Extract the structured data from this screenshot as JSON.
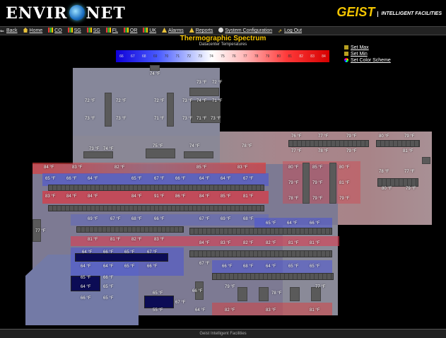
{
  "app": {
    "brand_left": "ENVIR",
    "brand_right": "NET",
    "vendor": "GEIST",
    "vendor_tag": "INTELLIGENT FACILITIES"
  },
  "nav": [
    {
      "label": "Back",
      "icon": "back-arrow-icon"
    },
    {
      "label": "Home",
      "icon": "home-icon"
    },
    {
      "label": "CO",
      "icon": "bar-chart-icon"
    },
    {
      "label": "SG",
      "icon": "bar-chart-icon"
    },
    {
      "label": "SG",
      "icon": "bar-chart-icon"
    },
    {
      "label": "FL",
      "icon": "bar-chart-icon"
    },
    {
      "label": "OR",
      "icon": "bar-chart-icon"
    },
    {
      "label": "UK",
      "icon": "bar-chart-icon"
    },
    {
      "label": "Alarms",
      "icon": "alarm-icon"
    },
    {
      "label": "Reports",
      "icon": "reports-icon"
    },
    {
      "label": "System Configuration",
      "icon": "gear-icon"
    },
    {
      "label": "Log Out",
      "icon": "logout-icon"
    }
  ],
  "title": "Thermographic Spectrum",
  "subtitle": "Datacenter Temperatures",
  "scale_values": [
    "66",
    "67",
    "68",
    "69",
    "70",
    "71",
    "72",
    "73",
    "74",
    "75",
    "76",
    "77",
    "78",
    "79",
    "80",
    "81",
    "82",
    "83",
    "84"
  ],
  "side_links": {
    "set_max": "Set Max",
    "set_min": "Set Min",
    "set_color_scheme": "Set Color Scheme"
  },
  "colors": {
    "accent": "#f5c400",
    "cold": "#0f00d8",
    "hot": "#d60000"
  },
  "temps": [
    {
      "t": "74 °F"
    },
    {
      "t": "73 °F"
    },
    {
      "t": "72 °F"
    },
    {
      "t": "72 °F"
    },
    {
      "t": "72 °F"
    },
    {
      "t": "72 °F"
    },
    {
      "t": "73 °F"
    },
    {
      "t": "74 °F"
    },
    {
      "t": "71 °F"
    },
    {
      "t": "73 °F"
    },
    {
      "t": "73 °F"
    },
    {
      "t": "71 °F"
    },
    {
      "t": "73 °F"
    },
    {
      "t": "71 °F"
    },
    {
      "t": "73 °F"
    },
    {
      "t": "76 °F"
    },
    {
      "t": "77 °F"
    },
    {
      "t": "79 °F"
    },
    {
      "t": "80 °F"
    },
    {
      "t": "79 °F"
    },
    {
      "t": "77 °F"
    },
    {
      "t": "78 °F"
    },
    {
      "t": "79 °F"
    },
    {
      "t": "81 °F"
    },
    {
      "t": "73 °F"
    },
    {
      "t": "74 °F"
    },
    {
      "t": "75 °F"
    },
    {
      "t": "74 °F"
    },
    {
      "t": "78 °F"
    },
    {
      "t": "84 °F"
    },
    {
      "t": "83 °F"
    },
    {
      "t": "82 °F"
    },
    {
      "t": "85 °F"
    },
    {
      "t": "83 °F"
    },
    {
      "t": "80 °F"
    },
    {
      "t": "85 °F"
    },
    {
      "t": "80 °F"
    },
    {
      "t": "78 °F"
    },
    {
      "t": "77 °F"
    },
    {
      "t": "65 °F"
    },
    {
      "t": "66 °F"
    },
    {
      "t": "64 °F"
    },
    {
      "t": "65 °F"
    },
    {
      "t": "67 °F"
    },
    {
      "t": "66 °F"
    },
    {
      "t": "64 °F"
    },
    {
      "t": "64 °F"
    },
    {
      "t": "67 °F"
    },
    {
      "t": "79 °F"
    },
    {
      "t": "79 °F"
    },
    {
      "t": "81 °F"
    },
    {
      "t": "80 °F"
    },
    {
      "t": "79 °F"
    },
    {
      "t": "83 °F"
    },
    {
      "t": "84 °F"
    },
    {
      "t": "84 °F"
    },
    {
      "t": "84 °F"
    },
    {
      "t": "91 °F"
    },
    {
      "t": "86 °F"
    },
    {
      "t": "84 °F"
    },
    {
      "t": "85 °F"
    },
    {
      "t": "81 °F"
    },
    {
      "t": "78 °F"
    },
    {
      "t": "79 °F"
    },
    {
      "t": "79 °F"
    },
    {
      "t": "69 °F"
    },
    {
      "t": "67 °F"
    },
    {
      "t": "68 °F"
    },
    {
      "t": "66 °F"
    },
    {
      "t": "67 °F"
    },
    {
      "t": "69 °F"
    },
    {
      "t": "68 °F"
    },
    {
      "t": "65 °F"
    },
    {
      "t": "64 °F"
    },
    {
      "t": "66 °F"
    },
    {
      "t": "77 °F"
    },
    {
      "t": "81 °F"
    },
    {
      "t": "81 °F"
    },
    {
      "t": "82 °F"
    },
    {
      "t": "83 °F"
    },
    {
      "t": "84 °F"
    },
    {
      "t": "83 °F"
    },
    {
      "t": "82 °F"
    },
    {
      "t": "82 °F"
    },
    {
      "t": "81 °F"
    },
    {
      "t": "81 °F"
    },
    {
      "t": "64 °F"
    },
    {
      "t": "66 °F"
    },
    {
      "t": "65 °F"
    },
    {
      "t": "67 °F"
    },
    {
      "t": "64 °F"
    },
    {
      "t": "64 °F"
    },
    {
      "t": "65 °F"
    },
    {
      "t": "66 °F"
    },
    {
      "t": "67 °F"
    },
    {
      "t": "66 °F"
    },
    {
      "t": "68 °F"
    },
    {
      "t": "64 °F"
    },
    {
      "t": "65 °F"
    },
    {
      "t": "65 °F"
    },
    {
      "t": "65 °F"
    },
    {
      "t": "66 °F"
    },
    {
      "t": "64 °F"
    },
    {
      "t": "65 °F"
    },
    {
      "t": "66 °F"
    },
    {
      "t": "65 °F"
    },
    {
      "t": "65 °F"
    },
    {
      "t": "66 °F"
    },
    {
      "t": "79 °F"
    },
    {
      "t": "78 °F"
    },
    {
      "t": "77 °F"
    },
    {
      "t": "55 °F"
    },
    {
      "t": "67 °F"
    },
    {
      "t": "64 °F"
    },
    {
      "t": "82 °F"
    },
    {
      "t": "83 °F"
    },
    {
      "t": "81 °F"
    }
  ],
  "footer": "Geist Intelligent Facilities"
}
